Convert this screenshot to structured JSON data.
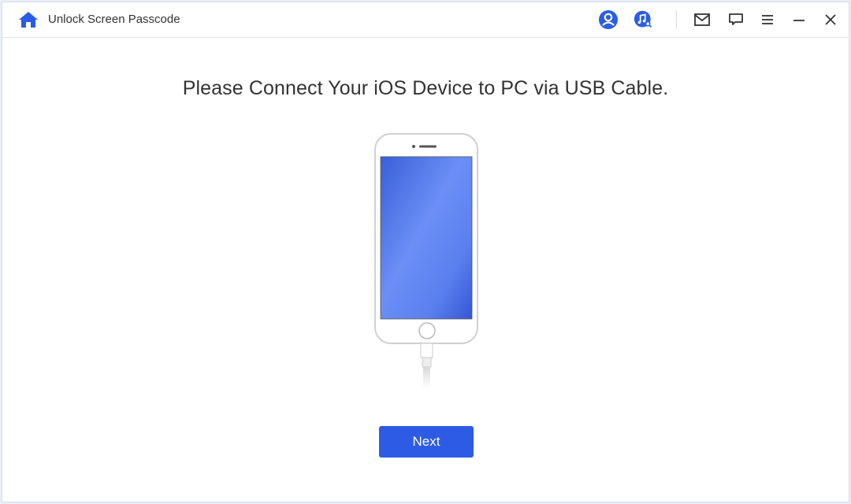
{
  "window": {
    "title": "Unlock Screen Passcode"
  },
  "toolbar": {
    "icons": [
      {
        "name": "account-icon",
        "label": "Account"
      },
      {
        "name": "music-search-icon",
        "label": "Music search"
      },
      {
        "name": "mail-icon",
        "label": "Mail"
      },
      {
        "name": "feedback-icon",
        "label": "Feedback"
      },
      {
        "name": "menu-icon",
        "label": "Menu"
      },
      {
        "name": "minimize-icon",
        "label": "Minimize"
      },
      {
        "name": "close-icon",
        "label": "Close"
      }
    ]
  },
  "main": {
    "heading": "Please Connect Your iOS Device to PC via USB Cable.",
    "next_label": "Next"
  },
  "colors": {
    "accent": "#2d5be3",
    "screen_dark": "#3a5fd8",
    "screen_light": "#6b8ff5"
  }
}
